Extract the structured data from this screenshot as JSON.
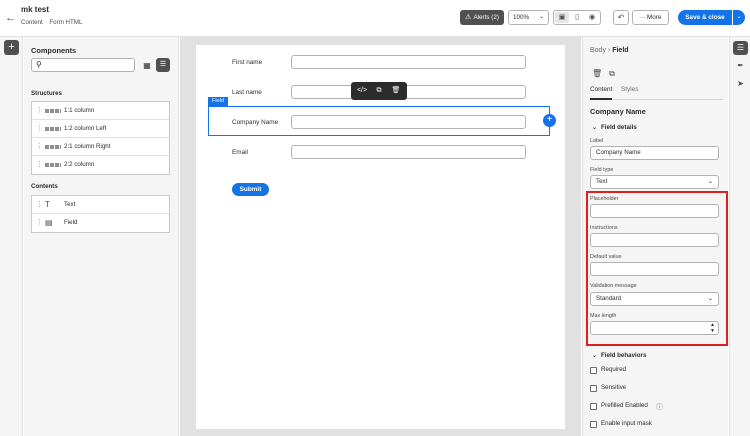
{
  "header": {
    "title": "mk test",
    "breadcrumbs": [
      "Content",
      "Form HTML"
    ],
    "alerts_label": "Alerts (2)",
    "zoom_value": "100%",
    "more_label": "More",
    "save_label": "Save & close"
  },
  "components": {
    "title": "Components",
    "search_placeholder": "",
    "structures_label": "Structures",
    "structures": [
      "1:1 column",
      "1:2 column Left",
      "2:1 column Right",
      "2:2 column"
    ],
    "contents_label": "Contents",
    "contents": [
      "Text",
      "Field"
    ]
  },
  "form": {
    "rows": [
      {
        "label": "First name"
      },
      {
        "label": "Last name"
      },
      {
        "label": "Company Name"
      },
      {
        "label": "Email"
      }
    ],
    "field_tag": "Field",
    "submit_label": "Submit"
  },
  "props": {
    "crumb_root": "Body",
    "crumb_current": "Field",
    "tabs": [
      "Content",
      "Styles"
    ],
    "heading": "Company Name",
    "field_details_label": "Field details",
    "label_label": "Label",
    "label_value": "Company Name",
    "field_type_label": "Field type",
    "field_type_value": "Text",
    "placeholder_label": "Placeholder",
    "instructions_label": "Instructions",
    "default_value_label": "Default value",
    "validation_label": "Validation message",
    "validation_value": "Standard",
    "max_length_label": "Max length",
    "field_behaviors_label": "Field behaviors",
    "checks": [
      "Required",
      "Sensitive",
      "Prefilled Enabled",
      "Enable input mask"
    ]
  },
  "colors": {
    "accent": "#1473e6",
    "highlight": "#e02020",
    "dark_button": "#505050"
  }
}
